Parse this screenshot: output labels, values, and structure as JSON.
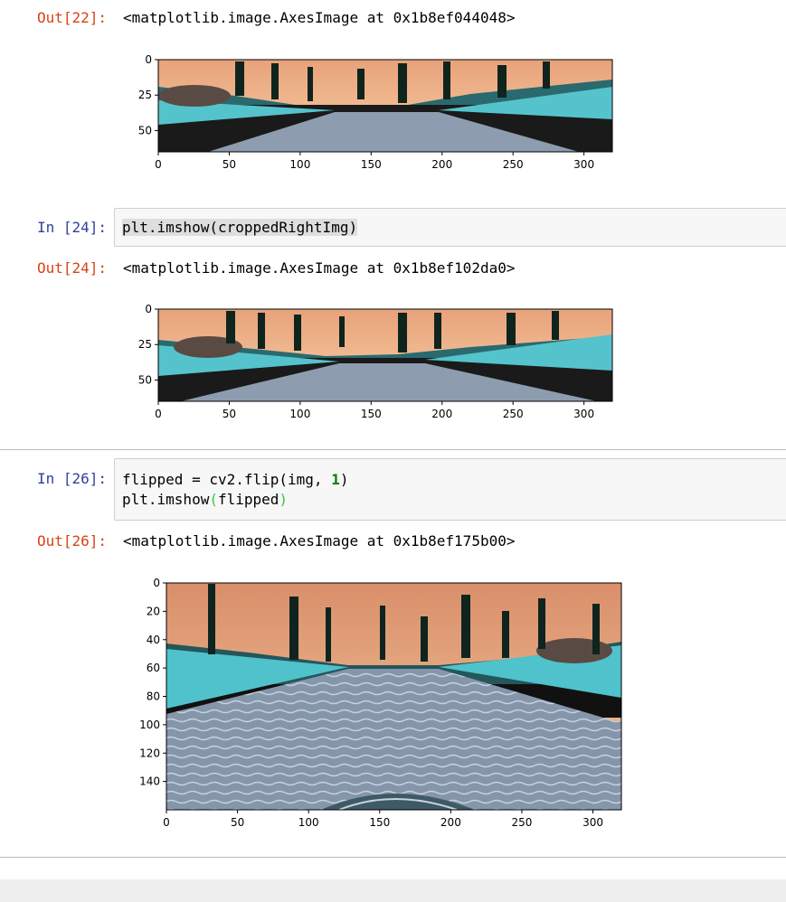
{
  "cells": {
    "out22": {
      "prompt": "Out[22]:",
      "text": "<matplotlib.image.AxesImage at 0x1b8ef044048>"
    },
    "in24": {
      "prompt": "In [24]:",
      "code": "plt.imshow(croppedRightImg)"
    },
    "out24": {
      "prompt": "Out[24]:",
      "text": "<matplotlib.image.AxesImage at 0x1b8ef102da0>"
    },
    "in26": {
      "prompt": "In [26]:",
      "line1_a": "flipped = cv2.flip(img, ",
      "line1_num": "1",
      "line1_b": ")",
      "line2_a": "plt.imshow",
      "line2_open": "(",
      "line2_mid": "flipped",
      "line2_close": ")"
    },
    "out26": {
      "prompt": "Out[26]:",
      "text": "<matplotlib.image.AxesImage at 0x1b8ef175b00>"
    }
  },
  "plots": {
    "plot1": {
      "yticks": [
        "0",
        "25",
        "50"
      ],
      "xticks": [
        "0",
        "50",
        "100",
        "150",
        "200",
        "250",
        "300"
      ]
    },
    "plot2": {
      "yticks": [
        "0",
        "25",
        "50"
      ],
      "xticks": [
        "0",
        "50",
        "100",
        "150",
        "200",
        "250",
        "300"
      ]
    },
    "plot3": {
      "yticks": [
        "0",
        "20",
        "40",
        "60",
        "80",
        "100",
        "120",
        "140"
      ],
      "xticks": [
        "0",
        "50",
        "100",
        "150",
        "200",
        "250",
        "300"
      ]
    }
  },
  "colors": {
    "out_prompt": "#d84315",
    "in_prompt": "#303f9f",
    "sky": "#f0b48c",
    "road": "#8ea0b4",
    "ice": "#5cc8d4"
  }
}
